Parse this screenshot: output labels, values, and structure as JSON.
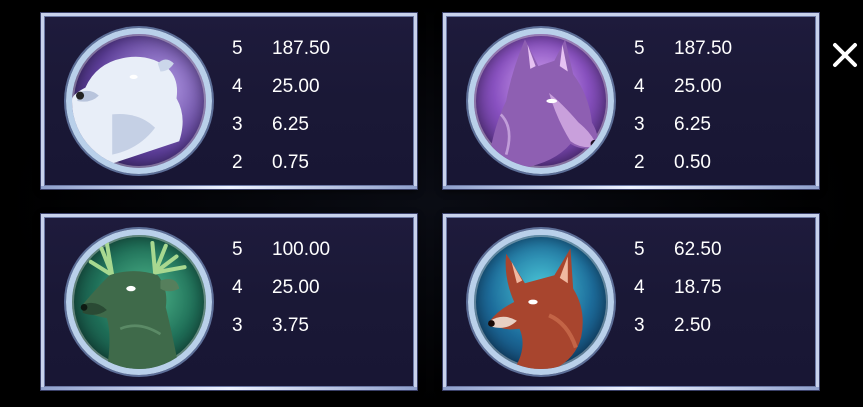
{
  "paytable": [
    {
      "symbol_icon": "polar-bear-icon",
      "pays": [
        {
          "count": "5",
          "value": "187.50"
        },
        {
          "count": "4",
          "value": "25.00"
        },
        {
          "count": "3",
          "value": "6.25"
        },
        {
          "count": "2",
          "value": "0.75"
        }
      ]
    },
    {
      "symbol_icon": "wolf-icon",
      "pays": [
        {
          "count": "5",
          "value": "187.50"
        },
        {
          "count": "4",
          "value": "25.00"
        },
        {
          "count": "3",
          "value": "6.25"
        },
        {
          "count": "2",
          "value": "0.50"
        }
      ]
    },
    {
      "symbol_icon": "stag-icon",
      "pays": [
        {
          "count": "5",
          "value": "100.00"
        },
        {
          "count": "4",
          "value": "25.00"
        },
        {
          "count": "3",
          "value": "3.75"
        }
      ]
    },
    {
      "symbol_icon": "fox-icon",
      "pays": [
        {
          "count": "5",
          "value": "62.50"
        },
        {
          "count": "4",
          "value": "18.75"
        },
        {
          "count": "3",
          "value": "2.50"
        }
      ]
    }
  ],
  "close_icon": "close-icon",
  "colors": {
    "panel": "#1c1a3a",
    "border": "#c8d2ec",
    "text": "#ffffff"
  }
}
